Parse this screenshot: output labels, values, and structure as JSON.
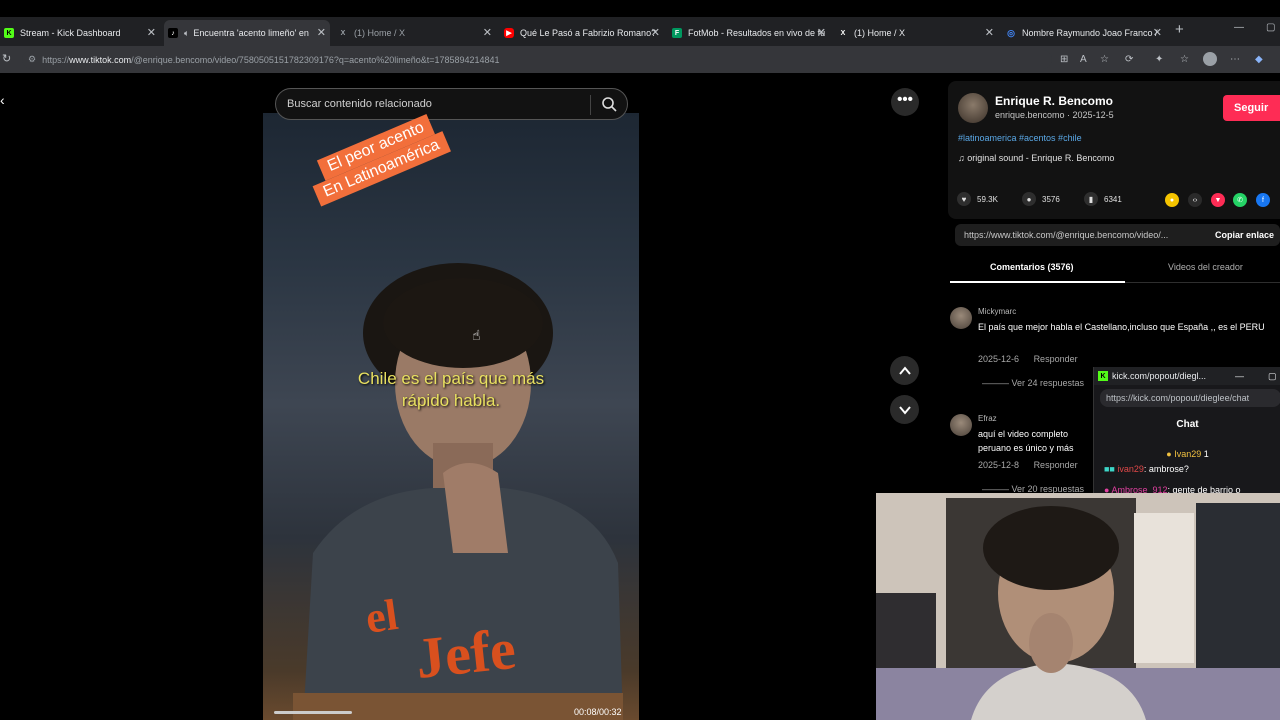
{
  "browser": {
    "tabs": [
      {
        "title": "Stream - Kick Dashboard",
        "favicon": "kick-icon",
        "color": "#53fc18",
        "glyph": "K"
      },
      {
        "title": "Encuentra 'acento limeño' en",
        "favicon": "tiktok-icon",
        "color": "#000000",
        "glyph": "♪"
      },
      {
        "title": "(1) Home / X",
        "favicon": "x-icon",
        "color": "#000000",
        "glyph": "X"
      },
      {
        "title": "Qué Le Pasó a Fabrizio Romano?",
        "favicon": "youtube-icon",
        "color": "#ff0000",
        "glyph": "▶"
      },
      {
        "title": "FotMob - Resultados en vivo de fú",
        "favicon": "fotmob-icon",
        "color": "#00985f",
        "glyph": "F"
      },
      {
        "title": "(1) Home / X",
        "favicon": "x-icon",
        "color": "#000000",
        "glyph": "X"
      },
      {
        "title": "Nombre Raymundo Joao Franco /",
        "favicon": "globe-icon",
        "color": "#4285f4",
        "glyph": "◎"
      }
    ],
    "new_tab": "+",
    "url": {
      "prefix": "https://",
      "host": "www.tiktok.com",
      "path": "/@enrique.bencomo/video/7580505151782309176?q=acento%20limeño&t=1785894214841"
    }
  },
  "video": {
    "search_placeholder": "Buscar contenido relacionado",
    "sticker_line1": "El peor acento",
    "sticker_line2": "En Latinoamérica",
    "caption_line1": "Chile es el país que más",
    "caption_line2": "rápido habla.",
    "shirt_text_1": "el",
    "shirt_text_2": "Jefe",
    "timecode": "00:08/00:32",
    "progress": 0.25
  },
  "creator": {
    "name": "Enrique R. Bencomo",
    "handle_date": "enrique.bencomo · 2025-12-5",
    "follow_label": "Seguir",
    "tags": "#latinoamerica #acentos #chile",
    "sound": "original sound - Enrique R. Bencomo",
    "likes": "59.3K",
    "comments": "3576",
    "saves": "6341",
    "link": "https://www.tiktok.com/@enrique.bencomo/video/...",
    "copy_label": "Copiar enlace"
  },
  "tabs": {
    "comments": "Comentarios (3576)",
    "creator_videos": "Videos del creador"
  },
  "comments": [
    {
      "user": "Mickymarc",
      "text": "El país que mejor habla el Castellano,incluso que España ,, es el PERU",
      "date": "2025-12-6",
      "reply": "Responder",
      "more": "Ver 24 respuestas"
    },
    {
      "user": "Efraz",
      "text": "aquí el video completo",
      "text2": "peruano es único y más",
      "date": "2025-12-8",
      "reply": "Responder",
      "more": "Ver 20 respuestas"
    }
  ],
  "popout": {
    "title": "kick.com/popout/diegl...",
    "url": "https://kick.com/popout/dieglee/chat",
    "chat_label": "Chat",
    "pinned_user": "Ivan29",
    "pinned_count": "1",
    "msg1_user": "ivan29",
    "msg1_text": ": ambrose?",
    "msg2_user": "Ambrose_912",
    "msg2_text": ": gente de barrio o"
  }
}
